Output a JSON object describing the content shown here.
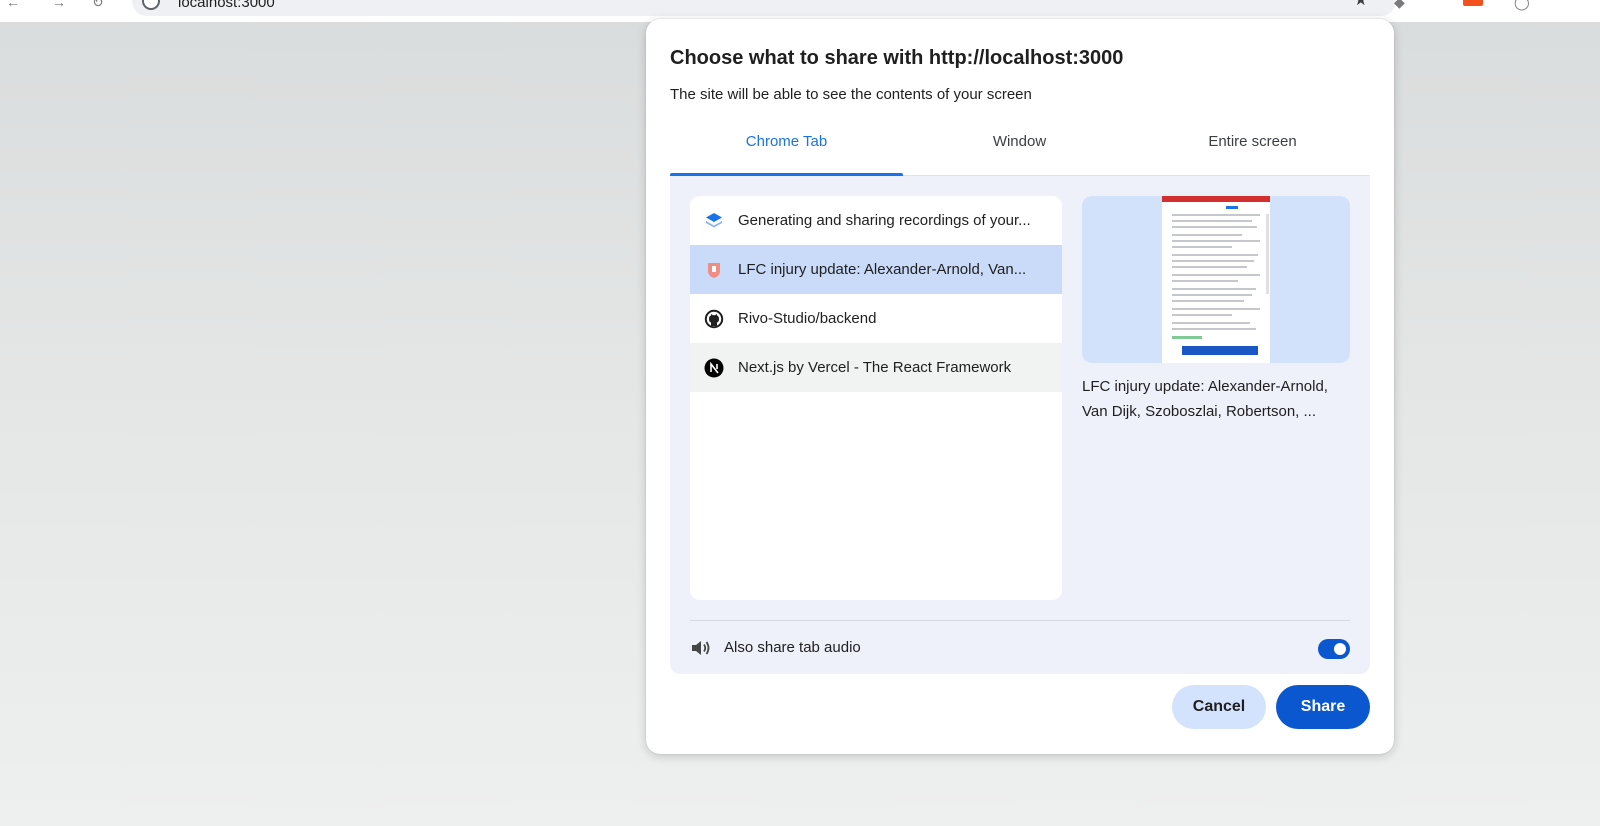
{
  "browser": {
    "url": "localhost:3000"
  },
  "dialog": {
    "title": "Choose what to share with http://localhost:3000",
    "subtitle": "The site will be able to see the contents of your screen",
    "tabs": [
      {
        "label": "Chrome Tab",
        "active": true
      },
      {
        "label": "Window",
        "active": false
      },
      {
        "label": "Entire screen",
        "active": false
      }
    ],
    "sources": [
      {
        "label": "Generating and sharing recordings of your...",
        "icon": "layers-icon",
        "state": "normal"
      },
      {
        "label": "LFC injury update: Alexander-Arnold, Van...",
        "icon": "lfc-crest-icon",
        "state": "selected"
      },
      {
        "label": "Rivo-Studio/backend",
        "icon": "github-icon",
        "state": "normal"
      },
      {
        "label": "Next.js by Vercel - The React Framework",
        "icon": "nextjs-icon",
        "state": "hovered"
      }
    ],
    "preview_caption_line1": "LFC injury update: Alexander-Arnold,",
    "preview_caption_line2": "Van Dijk, Szoboszlai, Robertson, ...",
    "audio_label": "Also share tab audio",
    "audio_enabled": true,
    "cancel_label": "Cancel",
    "share_label": "Share"
  },
  "colors": {
    "accent": "#1a73e8",
    "primary_button": "#0b57d0",
    "selected_row": "#c9dbf8",
    "panel_bg": "#eef1f9",
    "preview_bg": "#d3e2fb"
  }
}
